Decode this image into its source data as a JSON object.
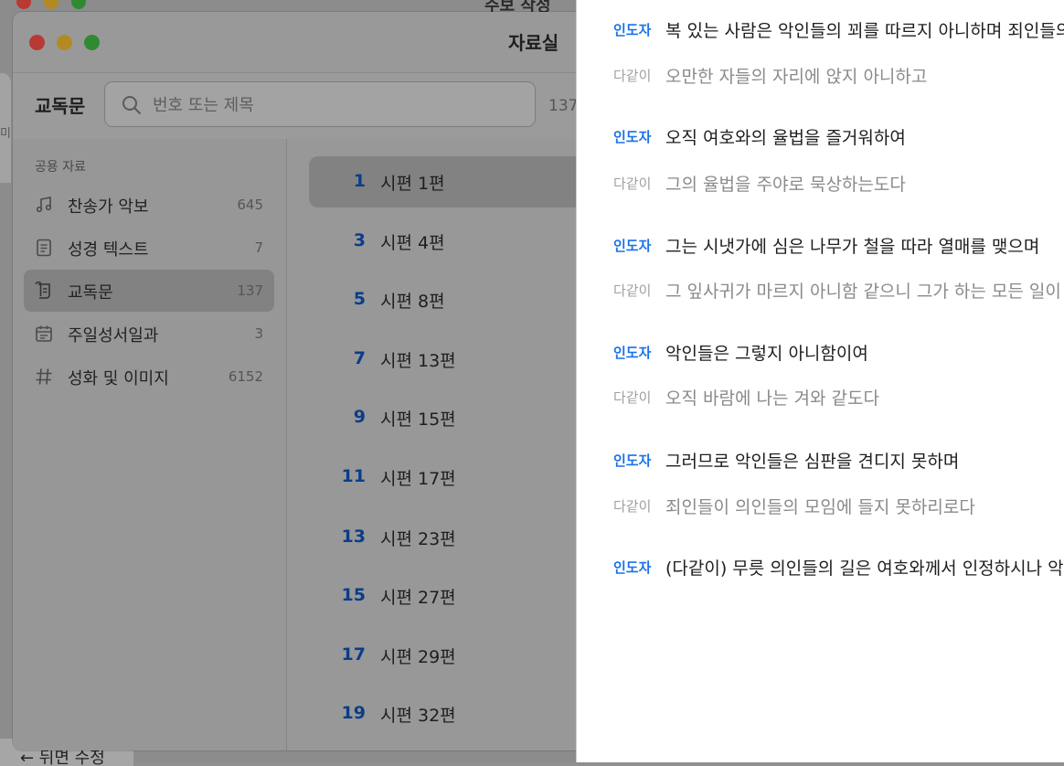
{
  "background_window": {
    "title_fragment": "주보 작성",
    "bottom_button": "← 뒤면 수정",
    "left_fragment": "미"
  },
  "window": {
    "title": "자료실"
  },
  "toolbar": {
    "title": "교독문",
    "search_placeholder": "번호 또는 제목",
    "count": "137"
  },
  "sidebar": {
    "section_label": "공용 자료",
    "items": [
      {
        "label": "찬송가 악보",
        "count": "645",
        "icon": "music-note-icon"
      },
      {
        "label": "성경 텍스트",
        "count": "7",
        "icon": "document-icon"
      },
      {
        "label": "교독문",
        "count": "137",
        "icon": "scroll-icon",
        "selected": true
      },
      {
        "label": "주일성서일과",
        "count": "3",
        "icon": "calendar-icon"
      },
      {
        "label": "성화 및 이미지",
        "count": "6152",
        "icon": "hashtag-icon"
      }
    ]
  },
  "list": {
    "items": [
      {
        "num": "1",
        "name": "시편 1편",
        "selected": true
      },
      {
        "num": "3",
        "name": "시편 4편"
      },
      {
        "num": "5",
        "name": "시편 8편"
      },
      {
        "num": "7",
        "name": "시편 13편"
      },
      {
        "num": "9",
        "name": "시편 15편"
      },
      {
        "num": "11",
        "name": "시편 17편"
      },
      {
        "num": "13",
        "name": "시편 23편"
      },
      {
        "num": "15",
        "name": "시편 27편"
      },
      {
        "num": "17",
        "name": "시편 29편"
      },
      {
        "num": "19",
        "name": "시편 32편"
      }
    ]
  },
  "reading": {
    "roles": {
      "leader": "인도자",
      "all": "다같이"
    },
    "lines": [
      {
        "role": "leader",
        "text": "복 있는 사람은 악인들의 꾀를 따르지 아니하며 죄인들의 길에 서지 아니하며"
      },
      {
        "role": "all",
        "text": "오만한 자들의 자리에 앉지 아니하고"
      },
      {
        "role": "leader",
        "text": "오직 여호와의 율법을 즐거워하여"
      },
      {
        "role": "all",
        "text": "그의 율법을 주야로 묵상하는도다"
      },
      {
        "role": "leader",
        "text": "그는 시냇가에 심은 나무가 철을 따라 열매를 맺으며"
      },
      {
        "role": "all",
        "text": "그 잎사귀가 마르지 아니함 같으니 그가 하는 모든 일이 다 형통하리로다"
      },
      {
        "role": "leader",
        "text": "악인들은 그렇지 아니함이여"
      },
      {
        "role": "all",
        "text": "오직 바람에 나는 겨와 같도다"
      },
      {
        "role": "leader",
        "text": "그러므로 악인들은 심판을 견디지 못하며"
      },
      {
        "role": "all",
        "text": "죄인들이 의인들의 모임에 들지 못하리로다"
      },
      {
        "role": "leader",
        "text": "(다같이) 무릇 의인들의 길은 여호와께서 인정하시나 악인들의 길은 망하리로다"
      }
    ]
  },
  "colors": {
    "accent": "#1a73e8",
    "list_number": "#0a3d8a"
  }
}
